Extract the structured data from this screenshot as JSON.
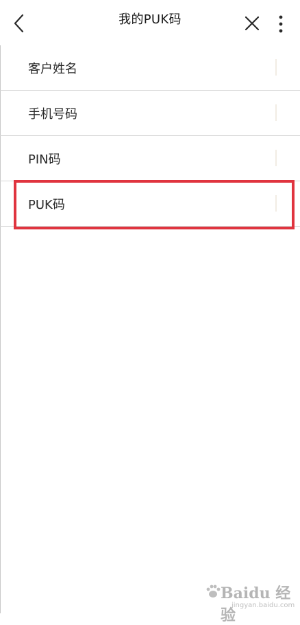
{
  "navbar": {
    "title": "我的PUK码",
    "back_icon": "chevron-left-icon",
    "close_icon": "close-icon",
    "more_icon": "more-vertical-icon"
  },
  "form": {
    "rows": [
      {
        "label": "客户姓名",
        "value": ""
      },
      {
        "label": "手机号码",
        "value": ""
      },
      {
        "label": "PIN码",
        "value": ""
      },
      {
        "label": "PUK码",
        "value": ""
      }
    ]
  },
  "highlight": {
    "target": "PUK码",
    "color": "#e0343f"
  },
  "watermark": {
    "main": "Baidu 经验",
    "sub": "jingyan.baidu.com"
  },
  "colors": {
    "background": "#ffffff",
    "divider": "#d6d6d6",
    "text": "#2a2a2a"
  }
}
